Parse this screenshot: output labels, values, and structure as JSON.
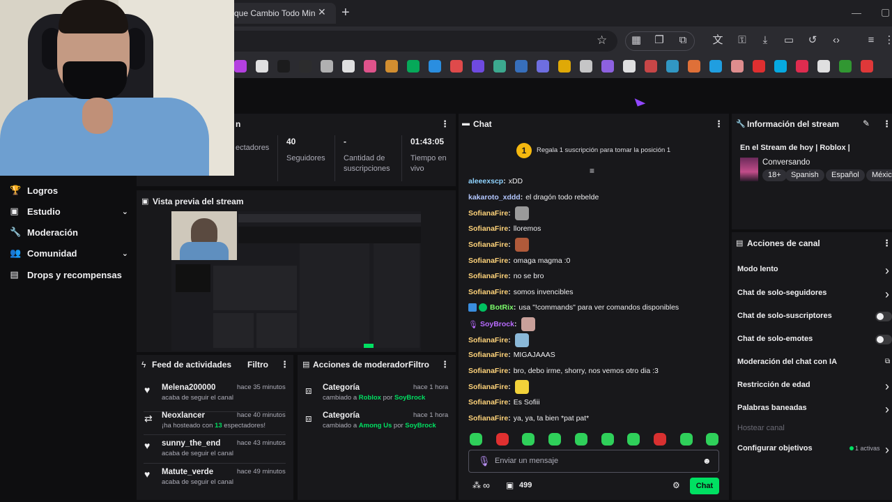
{
  "browser": {
    "tab_title": "que Cambio Todo Min",
    "tab_close": "✕",
    "new_tab": "+",
    "win_min": "—",
    "win_max": "▢"
  },
  "header": {
    "logo": "◣"
  },
  "sidebar": {
    "items": [
      {
        "label": "Logros",
        "icon": "trophy-icon",
        "glyph": "🏆"
      },
      {
        "label": "Estudio",
        "icon": "studio-icon",
        "glyph": "▣",
        "chevron": "⌄"
      },
      {
        "label": "Moderación",
        "icon": "wrench-icon",
        "glyph": "🔧"
      },
      {
        "label": "Comunidad",
        "icon": "community-icon",
        "glyph": "👥",
        "chevron": "⌄"
      },
      {
        "label": "Drops y recompensas",
        "icon": "drops-icon",
        "glyph": "▤"
      }
    ]
  },
  "stats_panel": {
    "title": "n",
    "stats": [
      {
        "value": "",
        "label": "ectadores"
      },
      {
        "value": "40",
        "label": "Seguidores"
      },
      {
        "value": "-",
        "label": "Cantidad de suscripciones"
      },
      {
        "value": "01:43:05",
        "label": "Tiempo en vivo"
      }
    ]
  },
  "preview": {
    "title": "Vista previa del stream"
  },
  "activity_feed": {
    "title": "Feed de actividades",
    "filter": "Filtro",
    "items": [
      {
        "name": "Melena200000",
        "time": "hace 35 minutos",
        "sub": "acaba de seguir el canal",
        "icon": "heart-icon",
        "glyph": "♥"
      },
      {
        "name": "Neoxlancer",
        "time": "hace 40 minutos",
        "sub_pre": "¡ha hosteado con ",
        "sub_num": "13",
        "sub_post": " espectadores!",
        "icon": "host-icon",
        "glyph": "⇄"
      },
      {
        "name": "sunny_the_end",
        "time": "hace 43 minutos",
        "sub": "acaba de seguir el canal",
        "icon": "heart-icon",
        "glyph": "♥"
      },
      {
        "name": "Matute_verde",
        "time": "hace 49 minutos",
        "sub": "acaba de seguir el canal",
        "icon": "heart-icon",
        "glyph": "♥"
      }
    ]
  },
  "mod_actions": {
    "title": "Acciones de moderador",
    "filter": "Filtro",
    "items": [
      {
        "name": "Categoría",
        "time": "hace 1 hora",
        "pre": "cambiado a ",
        "game": "Roblox",
        "mid": " por ",
        "user": "SoyBrock"
      },
      {
        "name": "Categoría",
        "time": "hace 1 hora",
        "pre": "cambiado a ",
        "game": "Among Us",
        "mid": " por ",
        "user": "SoyBrock"
      }
    ]
  },
  "chat": {
    "title": "Chat",
    "gift_badge": "1",
    "gift_text": "Regala 1 suscripción para tomar la posición 1",
    "messages": [
      {
        "user": "aleeexscp",
        "color": "#8fd3ff",
        "text": "xDD"
      },
      {
        "user": "kakaroto_xddd",
        "color": "#b3c7ff",
        "text": "el dragón todo rebelde"
      },
      {
        "user": "SofianaFire",
        "color": "#ffd37a",
        "text": "",
        "emote": "#9a9a9a"
      },
      {
        "user": "SofianaFire",
        "color": "#ffd37a",
        "text": "lloremos"
      },
      {
        "user": "SofianaFire",
        "color": "#ffd37a",
        "text": "",
        "emote": "#b05a3a"
      },
      {
        "user": "SofianaFire",
        "color": "#ffd37a",
        "text": "omaga magma :0"
      },
      {
        "user": "SofianaFire",
        "color": "#ffd37a",
        "text": "no se bro"
      },
      {
        "user": "SofianaFire",
        "color": "#ffd37a",
        "text": "somos invencibles"
      },
      {
        "user": "BotRix",
        "color": "#7cff6b",
        "text": "usa \"!commands\" para ver comandos disponibles",
        "badges": true
      },
      {
        "user": "SoyBrock",
        "color": "#b86bff",
        "text": "",
        "emote": "#c8a09a",
        "mic": true
      },
      {
        "user": "SofianaFire",
        "color": "#ffd37a",
        "text": "",
        "emote": "#8ab8d8"
      },
      {
        "user": "SofianaFire",
        "color": "#ffd37a",
        "text": "MIGAJAAAS"
      },
      {
        "user": "SofianaFire",
        "color": "#ffd37a",
        "text": "bro, debo irme, shorry, nos vemos otro dia :3"
      },
      {
        "user": "SofianaFire",
        "color": "#ffd37a",
        "text": "",
        "emote": "#f2d23a"
      },
      {
        "user": "SofianaFire",
        "color": "#ffd37a",
        "text": "Es Sofiii"
      },
      {
        "user": "SofianaFire",
        "color": "#ffd37a",
        "text": "ya, ya, ta bien *pat pat*"
      }
    ],
    "input_placeholder": "Enviar un mensaje",
    "points": "499",
    "send_label": "Chat",
    "infinity": "∞"
  },
  "stream_info": {
    "title": "Información del stream",
    "stream_title": "En el Stream de hoy | Roblox |",
    "category": "Conversando",
    "tags": [
      "18+",
      "Spanish",
      "Español",
      "Méxic"
    ]
  },
  "channel_actions": {
    "title": "Acciones de canal",
    "items": [
      {
        "label": "Modo lento",
        "control": "arrow"
      },
      {
        "label": "Chat de solo-seguidores",
        "control": "arrow"
      },
      {
        "label": "Chat de solo-suscriptores",
        "control": "toggle"
      },
      {
        "label": "Chat de solo-emotes",
        "control": "toggle"
      },
      {
        "label": "Moderación del chat con IA",
        "control": "external"
      },
      {
        "label": "Restricción de edad",
        "control": "arrow"
      },
      {
        "label": "Palabras baneadas",
        "control": "arrow"
      },
      {
        "label": "Hostear canal",
        "control": "none",
        "disabled": true
      },
      {
        "label": "Configurar objetivos",
        "control": "arrow",
        "badge": "1 activas"
      }
    ]
  },
  "colors": {
    "accent_green": "#00e062",
    "gift_gold": "#f5b80f",
    "panel_bg": "#18181b",
    "page_bg": "#0e0e10"
  }
}
